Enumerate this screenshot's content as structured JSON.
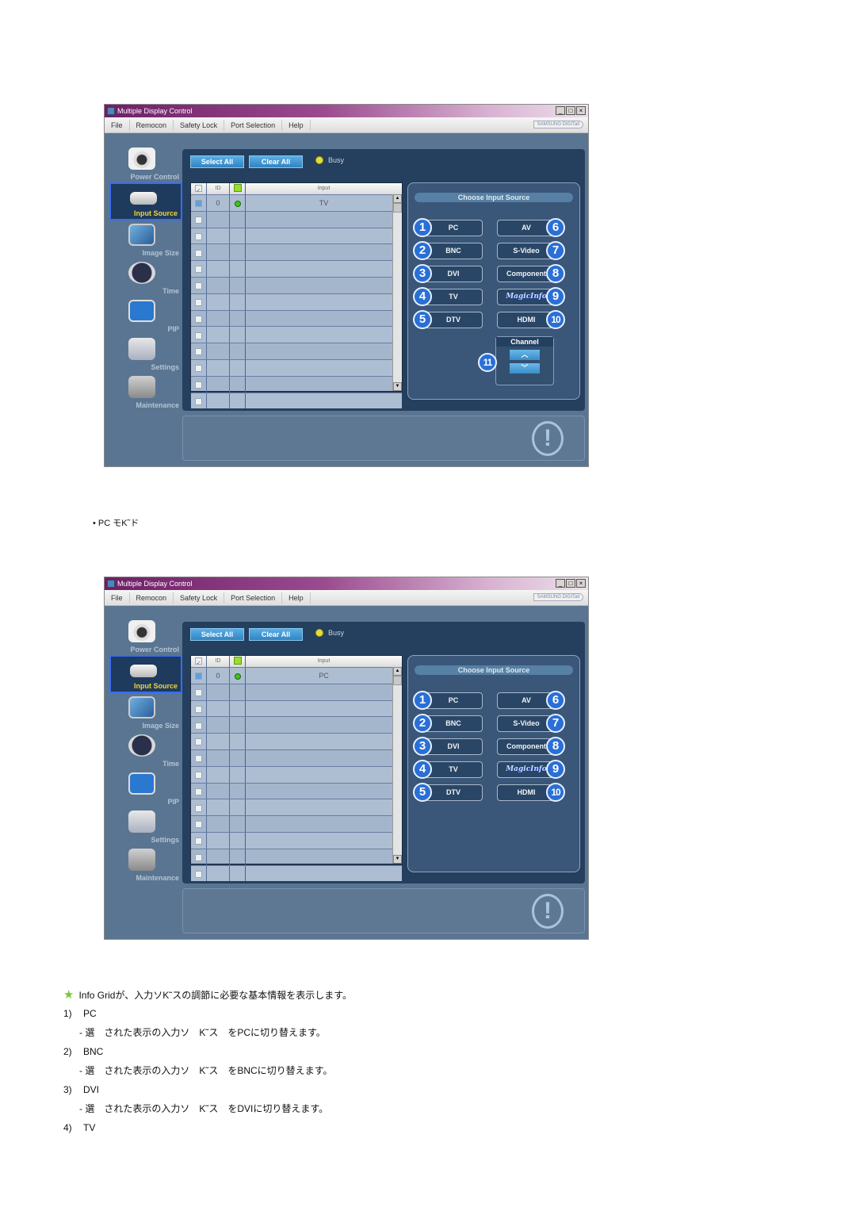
{
  "window": {
    "title": "Multiple Display Control",
    "controls": [
      "_",
      "□",
      "×"
    ],
    "menu": [
      "File",
      "Remocon",
      "Safety Lock",
      "Port Selection",
      "Help"
    ],
    "brand": "SAMSUNG DIGITall"
  },
  "sidebar": {
    "items": [
      {
        "label": "Power Control",
        "icon": "power-control-icon"
      },
      {
        "label": "Input Source",
        "icon": "input-source-icon",
        "active": true
      },
      {
        "label": "Image Size",
        "icon": "image-size-icon"
      },
      {
        "label": "Time",
        "icon": "time-icon"
      },
      {
        "label": "PIP",
        "icon": "pip-icon"
      },
      {
        "label": "Settings",
        "icon": "settings-icon"
      },
      {
        "label": "Maintenance",
        "icon": "maintenance-icon"
      }
    ]
  },
  "toolbar": {
    "select_all": "Select All",
    "clear_all": "Clear All",
    "busy_label": "Busy"
  },
  "grid": {
    "columns": [
      "ID",
      "Input"
    ],
    "screenshots": [
      {
        "rows": [
          {
            "checked": true,
            "id": "0",
            "status": "on",
            "input": "TV"
          }
        ]
      },
      {
        "rows": [
          {
            "checked": true,
            "id": "0",
            "status": "on",
            "input": "PC"
          }
        ]
      }
    ],
    "empty_rows": 12
  },
  "source_panel": {
    "title": "Choose Input Source",
    "buttons": [
      {
        "n": "1",
        "label": "PC"
      },
      {
        "n": "2",
        "label": "BNC"
      },
      {
        "n": "3",
        "label": "DVI"
      },
      {
        "n": "4",
        "label": "TV"
      },
      {
        "n": "5",
        "label": "DTV"
      },
      {
        "n": "6",
        "label": "AV"
      },
      {
        "n": "7",
        "label": "S-Video"
      },
      {
        "n": "8",
        "label": "Component"
      },
      {
        "n": "9",
        "label": "MagicInfo"
      },
      {
        "n": "10",
        "label": "HDMI"
      }
    ],
    "channel": {
      "n": "11",
      "title": "Channel",
      "up": "︿",
      "down": "﹀"
    }
  },
  "captions": {
    "pc_mode": "• PC モK˜ド"
  },
  "doc": {
    "intro": "Info Gridが、入力ソK˜スの調節に必要な基本情報を表示します。",
    "items": [
      {
        "num": "1)",
        "title": "PC",
        "desc": "- 選　された表示の入力ソ　K˜ス　をPCに切り替えます。"
      },
      {
        "num": "2)",
        "title": "BNC",
        "desc": "- 選　された表示の入力ソ　K˜ス　をBNCに切り替えます。"
      },
      {
        "num": "3)",
        "title": "DVI",
        "desc": "- 選　された表示の入力ソ　K˜ス　をDVIに切り替えます。"
      },
      {
        "num": "4)",
        "title": "TV",
        "desc": ""
      }
    ]
  }
}
